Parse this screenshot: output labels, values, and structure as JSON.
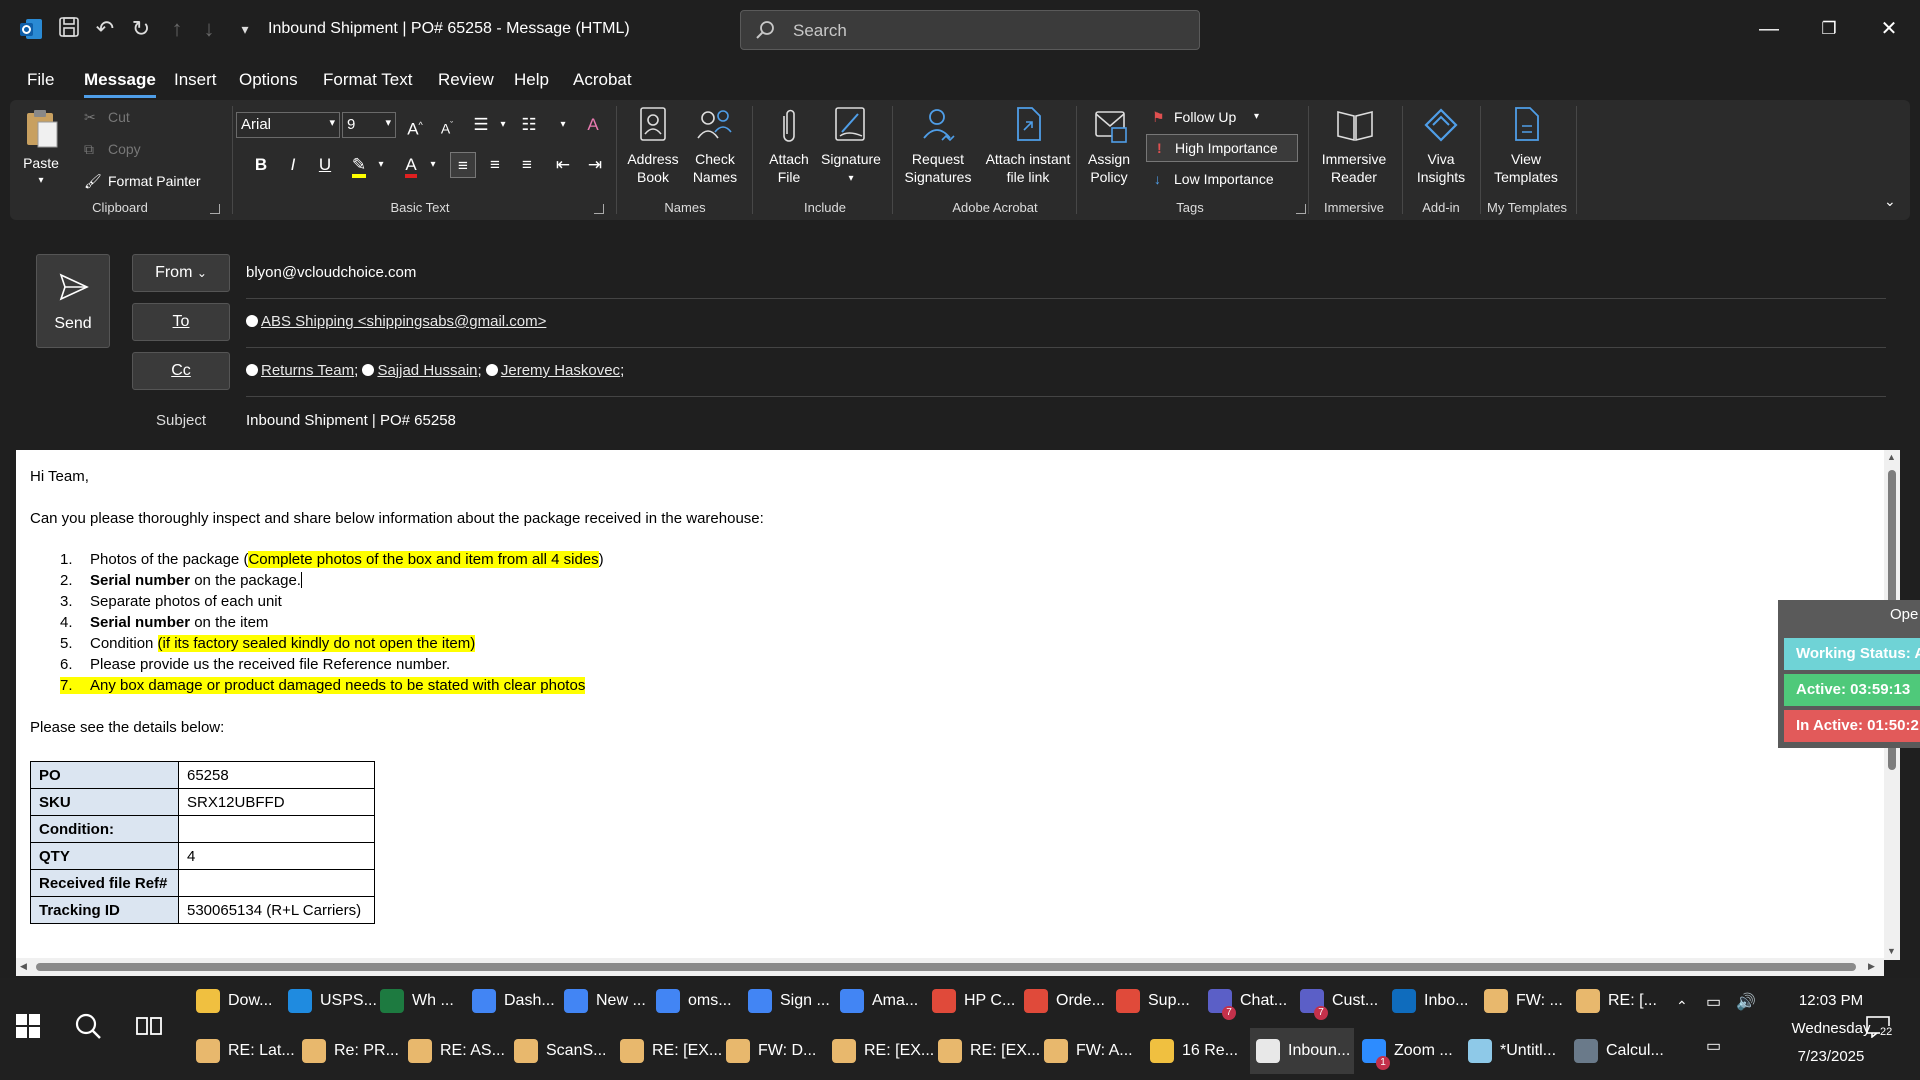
{
  "titlebar": {
    "title": "Inbound Shipment | PO# 65258  -  Message (HTML)",
    "search_placeholder": "Search"
  },
  "menu": {
    "tabs": [
      "File",
      "Message",
      "Insert",
      "Options",
      "Format Text",
      "Review",
      "Help",
      "Acrobat"
    ],
    "active": "Message"
  },
  "ribbon": {
    "clipboard": {
      "paste": "Paste",
      "cut": "Cut",
      "copy": "Copy",
      "format_painter": "Format Painter",
      "label": "Clipboard"
    },
    "basic_text": {
      "font": "Arial",
      "size": "9",
      "label": "Basic Text"
    },
    "names": {
      "address_book": "Address Book",
      "check_names": "Check Names",
      "label": "Names"
    },
    "include": {
      "attach_file": "Attach File",
      "signature": "Signature",
      "label": "Include"
    },
    "adobe": {
      "request_signatures": "Request Signatures",
      "attach_instant": "Attach instant file link",
      "label": "Adobe Acrobat"
    },
    "tags": {
      "assign_policy": "Assign Policy",
      "follow_up": "Follow Up",
      "high_importance": "High Importance",
      "low_importance": "Low Importance",
      "label": "Tags"
    },
    "immersive": {
      "reader": "Immersive Reader",
      "label": "Immersive"
    },
    "addin": {
      "viva": "Viva Insights",
      "label": "Add-in"
    },
    "templates": {
      "view": "View Templates",
      "label": "My Templates"
    }
  },
  "header": {
    "send": "Send",
    "from_label": "From",
    "from_value": "blyon@vcloudchoice.com",
    "to_label": "To",
    "to_recipient": "ABS Shipping <shippingsabs@gmail.com>",
    "cc_label": "Cc",
    "cc_recipients": [
      "Returns Team",
      "Sajjad Hussain",
      "Jeremy Haskovec"
    ],
    "subject_label": "Subject",
    "subject_value": "Inbound Shipment | PO# 65258"
  },
  "body": {
    "greeting": "Hi Team,",
    "intro": "Can you please thoroughly inspect and share below information about the package received in the warehouse:",
    "items": [
      {
        "num": "1.",
        "a": "Photos of the package (",
        "hl": "Complete photos of the box and item from all 4 sides",
        "b": ")"
      },
      {
        "num": "2.",
        "bold": "Serial number",
        "b": " on the package."
      },
      {
        "num": "3.",
        "a": "Separate photos of each unit"
      },
      {
        "num": "4.",
        "bold": "Serial number",
        "b": " on the item"
      },
      {
        "num": "5.",
        "a": "Condition ",
        "hl": "(if its factory sealed kindly do not open the item)"
      },
      {
        "num": "6.",
        "a": "Please provide us the received file Reference number."
      },
      {
        "num": "7.",
        "hl": "Any box damage or product damaged needs to be stated with clear photos"
      }
    ],
    "details_intro": "Please see the details below:",
    "table": [
      [
        "PO",
        "65258"
      ],
      [
        "SKU",
        "SRX12UBFFD"
      ],
      [
        "Condition:",
        ""
      ],
      [
        "QTY",
        "4"
      ],
      [
        "Received file Ref#",
        ""
      ],
      [
        "Tracking ID",
        "530065134 (R+L Carriers)"
      ]
    ]
  },
  "widget": {
    "title": "Ope",
    "working_status": "Working Status: A",
    "active": "Active: 03:59:13",
    "inactive": "In Active: 01:50:2",
    "colors": {
      "working": "#6fd3d6",
      "active": "#4fc97a",
      "inactive": "#e25a5a"
    }
  },
  "taskbar": {
    "row1": [
      {
        "label": "Dow...",
        "color": "#f0c040"
      },
      {
        "label": "USPS...",
        "color": "#1f8be0"
      },
      {
        "label": "Wh ...",
        "color": "#1d7a40"
      },
      {
        "label": "Dash...",
        "color": "#4285f4"
      },
      {
        "label": "New ...",
        "color": "#4285f4"
      },
      {
        "label": "oms...",
        "color": "#4285f4"
      },
      {
        "label": "Sign ...",
        "color": "#4285f4"
      },
      {
        "label": "Ama...",
        "color": "#4285f4"
      },
      {
        "label": "HP C...",
        "color": "#e04a3a"
      },
      {
        "label": "Orde...",
        "color": "#e04a3a"
      },
      {
        "label": "Sup...",
        "color": "#e04a3a"
      },
      {
        "label": "Chat...",
        "color": "#5b5fc7",
        "badge": "7"
      },
      {
        "label": "Cust...",
        "color": "#5b5fc7",
        "badge": "7"
      },
      {
        "label": "Inbo...",
        "color": "#0f6cbd"
      },
      {
        "label": "FW: ...",
        "color": "#e8b86d"
      },
      {
        "label": "RE: [...",
        "color": "#e8b86d"
      }
    ],
    "row2": [
      {
        "label": "RE: Lat...",
        "color": "#e8b86d"
      },
      {
        "label": "Re: PR...",
        "color": "#e8b86d"
      },
      {
        "label": "RE: AS...",
        "color": "#e8b86d"
      },
      {
        "label": "ScanS...",
        "color": "#e8b86d"
      },
      {
        "label": "RE: [EX...",
        "color": "#e8b86d"
      },
      {
        "label": "FW: D...",
        "color": "#e8b86d"
      },
      {
        "label": "RE: [EX...",
        "color": "#e8b86d"
      },
      {
        "label": "RE: [EX...",
        "color": "#e8b86d"
      },
      {
        "label": "FW: A...",
        "color": "#e8b86d"
      },
      {
        "label": "16 Re...",
        "color": "#f0c040"
      },
      {
        "label": "Inboun...",
        "color": "#e8e8e8",
        "active": true
      },
      {
        "label": "Zoom ...",
        "color": "#2d8cff",
        "badge": "1"
      },
      {
        "label": "*Untitl...",
        "color": "#8ec9e8"
      },
      {
        "label": "Calcul...",
        "color": "#6a7a8a"
      }
    ],
    "time": "12:03 PM",
    "day": "Wednesday",
    "date": "7/23/2025",
    "notifications": "22"
  }
}
